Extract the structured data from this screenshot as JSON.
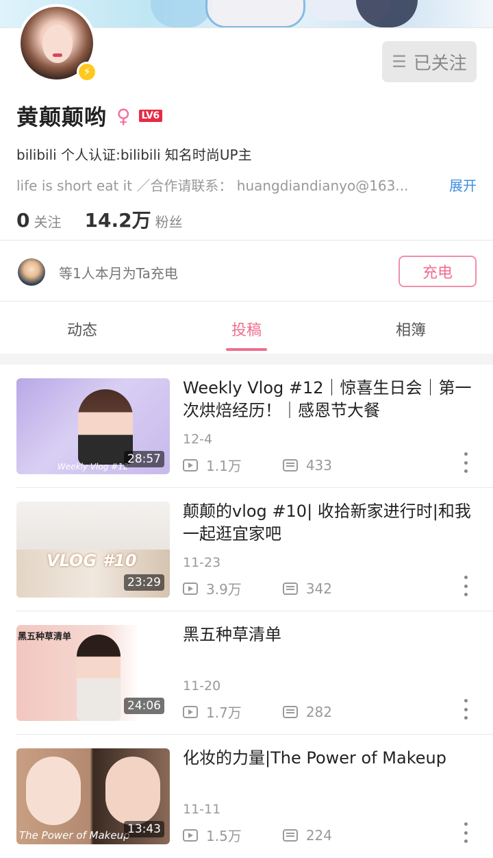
{
  "profile": {
    "name": "黄颠颠哟",
    "gender_symbol": "♀",
    "level": "LV6",
    "certification": "bilibili 个人认证:bilibili 知名时尚UP主",
    "signature": "life is short eat it ／合作请联系： huangdiandianyo@163...",
    "expand_label": "展开",
    "following_count": "0",
    "following_label": "关注",
    "followers_count": "14.2万",
    "followers_label": "粉丝",
    "follow_button_label": "已关注"
  },
  "charge": {
    "text": "等1人本月为Ta充电",
    "button_label": "充电"
  },
  "tabs": [
    {
      "label": "动态",
      "active": false
    },
    {
      "label": "投稿",
      "active": true
    },
    {
      "label": "相簿",
      "active": false
    }
  ],
  "videos": [
    {
      "title": "Weekly Vlog #12｜惊喜生日会｜第一次烘焙经历！｜感恩节大餐",
      "date": "12-4",
      "views": "1.1万",
      "danmaku": "433",
      "duration": "28:57",
      "thumb_caption": "Weekly Vlog #12"
    },
    {
      "title": "颠颠的vlog #10| 收拾新家进行时|和我一起逛宜家吧",
      "date": "11-23",
      "views": "3.9万",
      "danmaku": "342",
      "duration": "23:29",
      "thumb_caption": "VLOG #10"
    },
    {
      "title": "黑五种草清单",
      "date": "11-20",
      "views": "1.7万",
      "danmaku": "282",
      "duration": "24:06",
      "thumb_caption": "黑五种草清单"
    },
    {
      "title": "化妆的力量|The Power of Makeup",
      "date": "11-11",
      "views": "1.5万",
      "danmaku": "224",
      "duration": "13:43",
      "thumb_caption": "The Power of Makeup"
    }
  ],
  "colors": {
    "accent": "#f06d8e",
    "link": "#3b8ee0",
    "level_badge": "#e62c44",
    "bolt_badge": "#ffc81e"
  }
}
